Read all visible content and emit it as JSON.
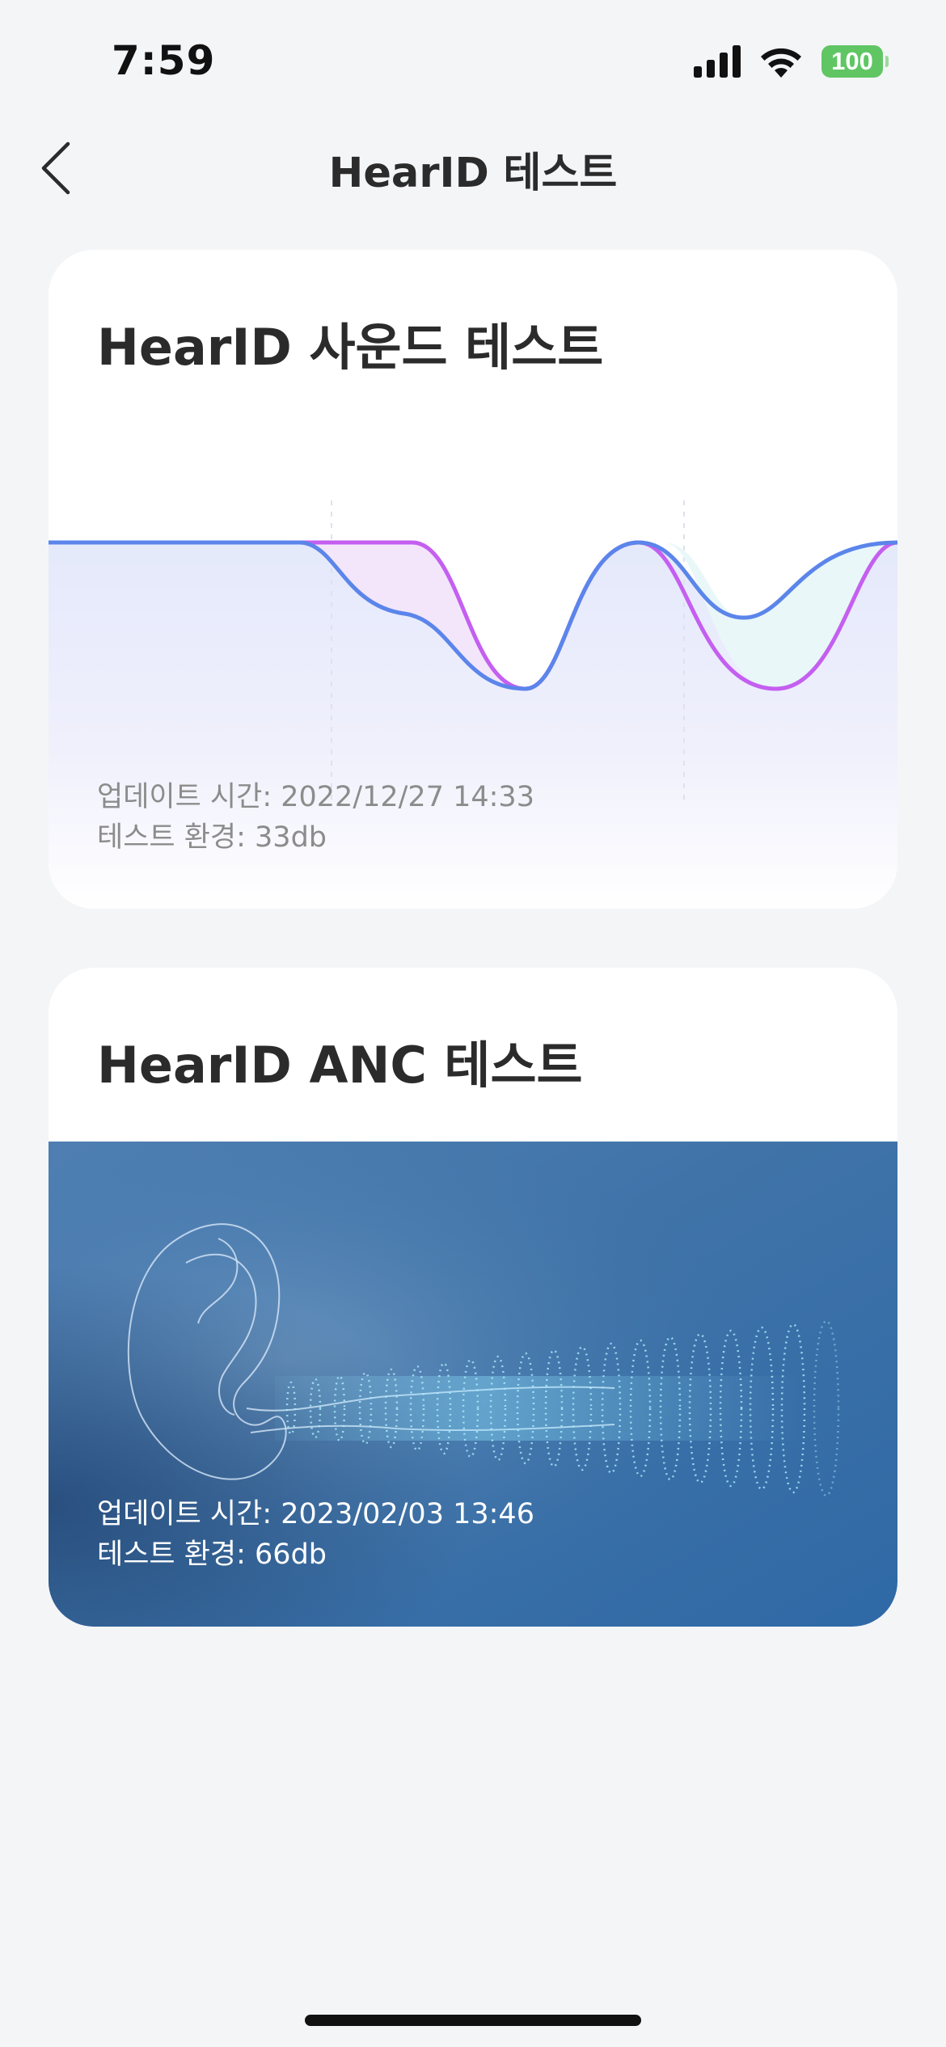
{
  "status_bar": {
    "time": "7:59",
    "battery": "100",
    "icons": [
      "signal-icon",
      "wifi-icon",
      "battery-icon"
    ]
  },
  "nav": {
    "title": "HearID 테스트",
    "back_icon": "chevron-left-icon"
  },
  "sound_test": {
    "title": "HearID 사운드 테스트",
    "updated": "업데이트 시간: 2022/12/27 14:33",
    "environment": "테스트 환경: 33db",
    "colors": {
      "blue_curve": "#5b85ea",
      "purple_curve": "#c45ff0",
      "purple_fill": "#f3e6fb",
      "teal_fill": "#e9f7f8"
    }
  },
  "anc_test": {
    "title": "HearID ANC 테스트",
    "updated": "업데이트 시간: 2023/02/03 13:46",
    "environment": "테스트 환경: 66db",
    "image": "ear-illustration"
  },
  "colors": {
    "background": "#f4f5f7",
    "card": "#ffffff",
    "battery": "#5fc663"
  }
}
